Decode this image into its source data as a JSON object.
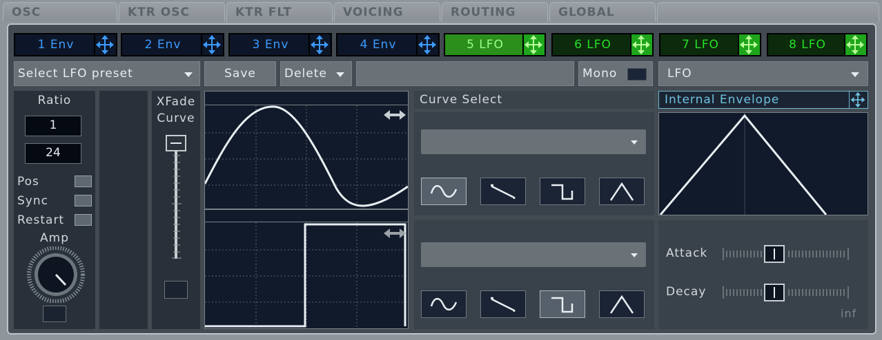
{
  "tabs": [
    {
      "label": "OSC"
    },
    {
      "label": "KTR OSC"
    },
    {
      "label": "KTR FLT"
    },
    {
      "label": "VOICING"
    },
    {
      "label": "ROUTING"
    },
    {
      "label": "GLOBAL"
    }
  ],
  "mod_sources": [
    {
      "label": "1 Env",
      "kind": "env"
    },
    {
      "label": "2 Env",
      "kind": "env"
    },
    {
      "label": "3 Env",
      "kind": "env"
    },
    {
      "label": "4 Env",
      "kind": "env"
    },
    {
      "label": "5 LFO",
      "kind": "lfo",
      "selected": true
    },
    {
      "label": "6 LFO",
      "kind": "lfo"
    },
    {
      "label": "7 LFO",
      "kind": "lfo"
    },
    {
      "label": "8 LFO",
      "kind": "lfo"
    }
  ],
  "toolbar": {
    "preset_select": "Select LFO preset",
    "save": "Save",
    "delete": "Delete",
    "preset_name": "",
    "mono": "Mono",
    "mode_select": "LFO"
  },
  "ratio": {
    "label": "Ratio",
    "numerator": "1",
    "denominator": "24"
  },
  "options": {
    "pos": "Pos",
    "sync": "Sync",
    "restart": "Restart"
  },
  "amp": {
    "label": "Amp"
  },
  "xfade": {
    "label_line1": "XFade",
    "label_line2": "Curve"
  },
  "curve_select": {
    "title": "Curve Select",
    "upper_selected": "sine",
    "lower_selected": "square"
  },
  "envelope": {
    "title": "Internal Envelope",
    "attack_label": "Attack",
    "decay_label": "Decay",
    "decay_value": "inf"
  },
  "colors": {
    "env": "#3d9bff",
    "lfo": "#27e027",
    "panel": "#434a51",
    "graph_bg": "#111a2a"
  }
}
